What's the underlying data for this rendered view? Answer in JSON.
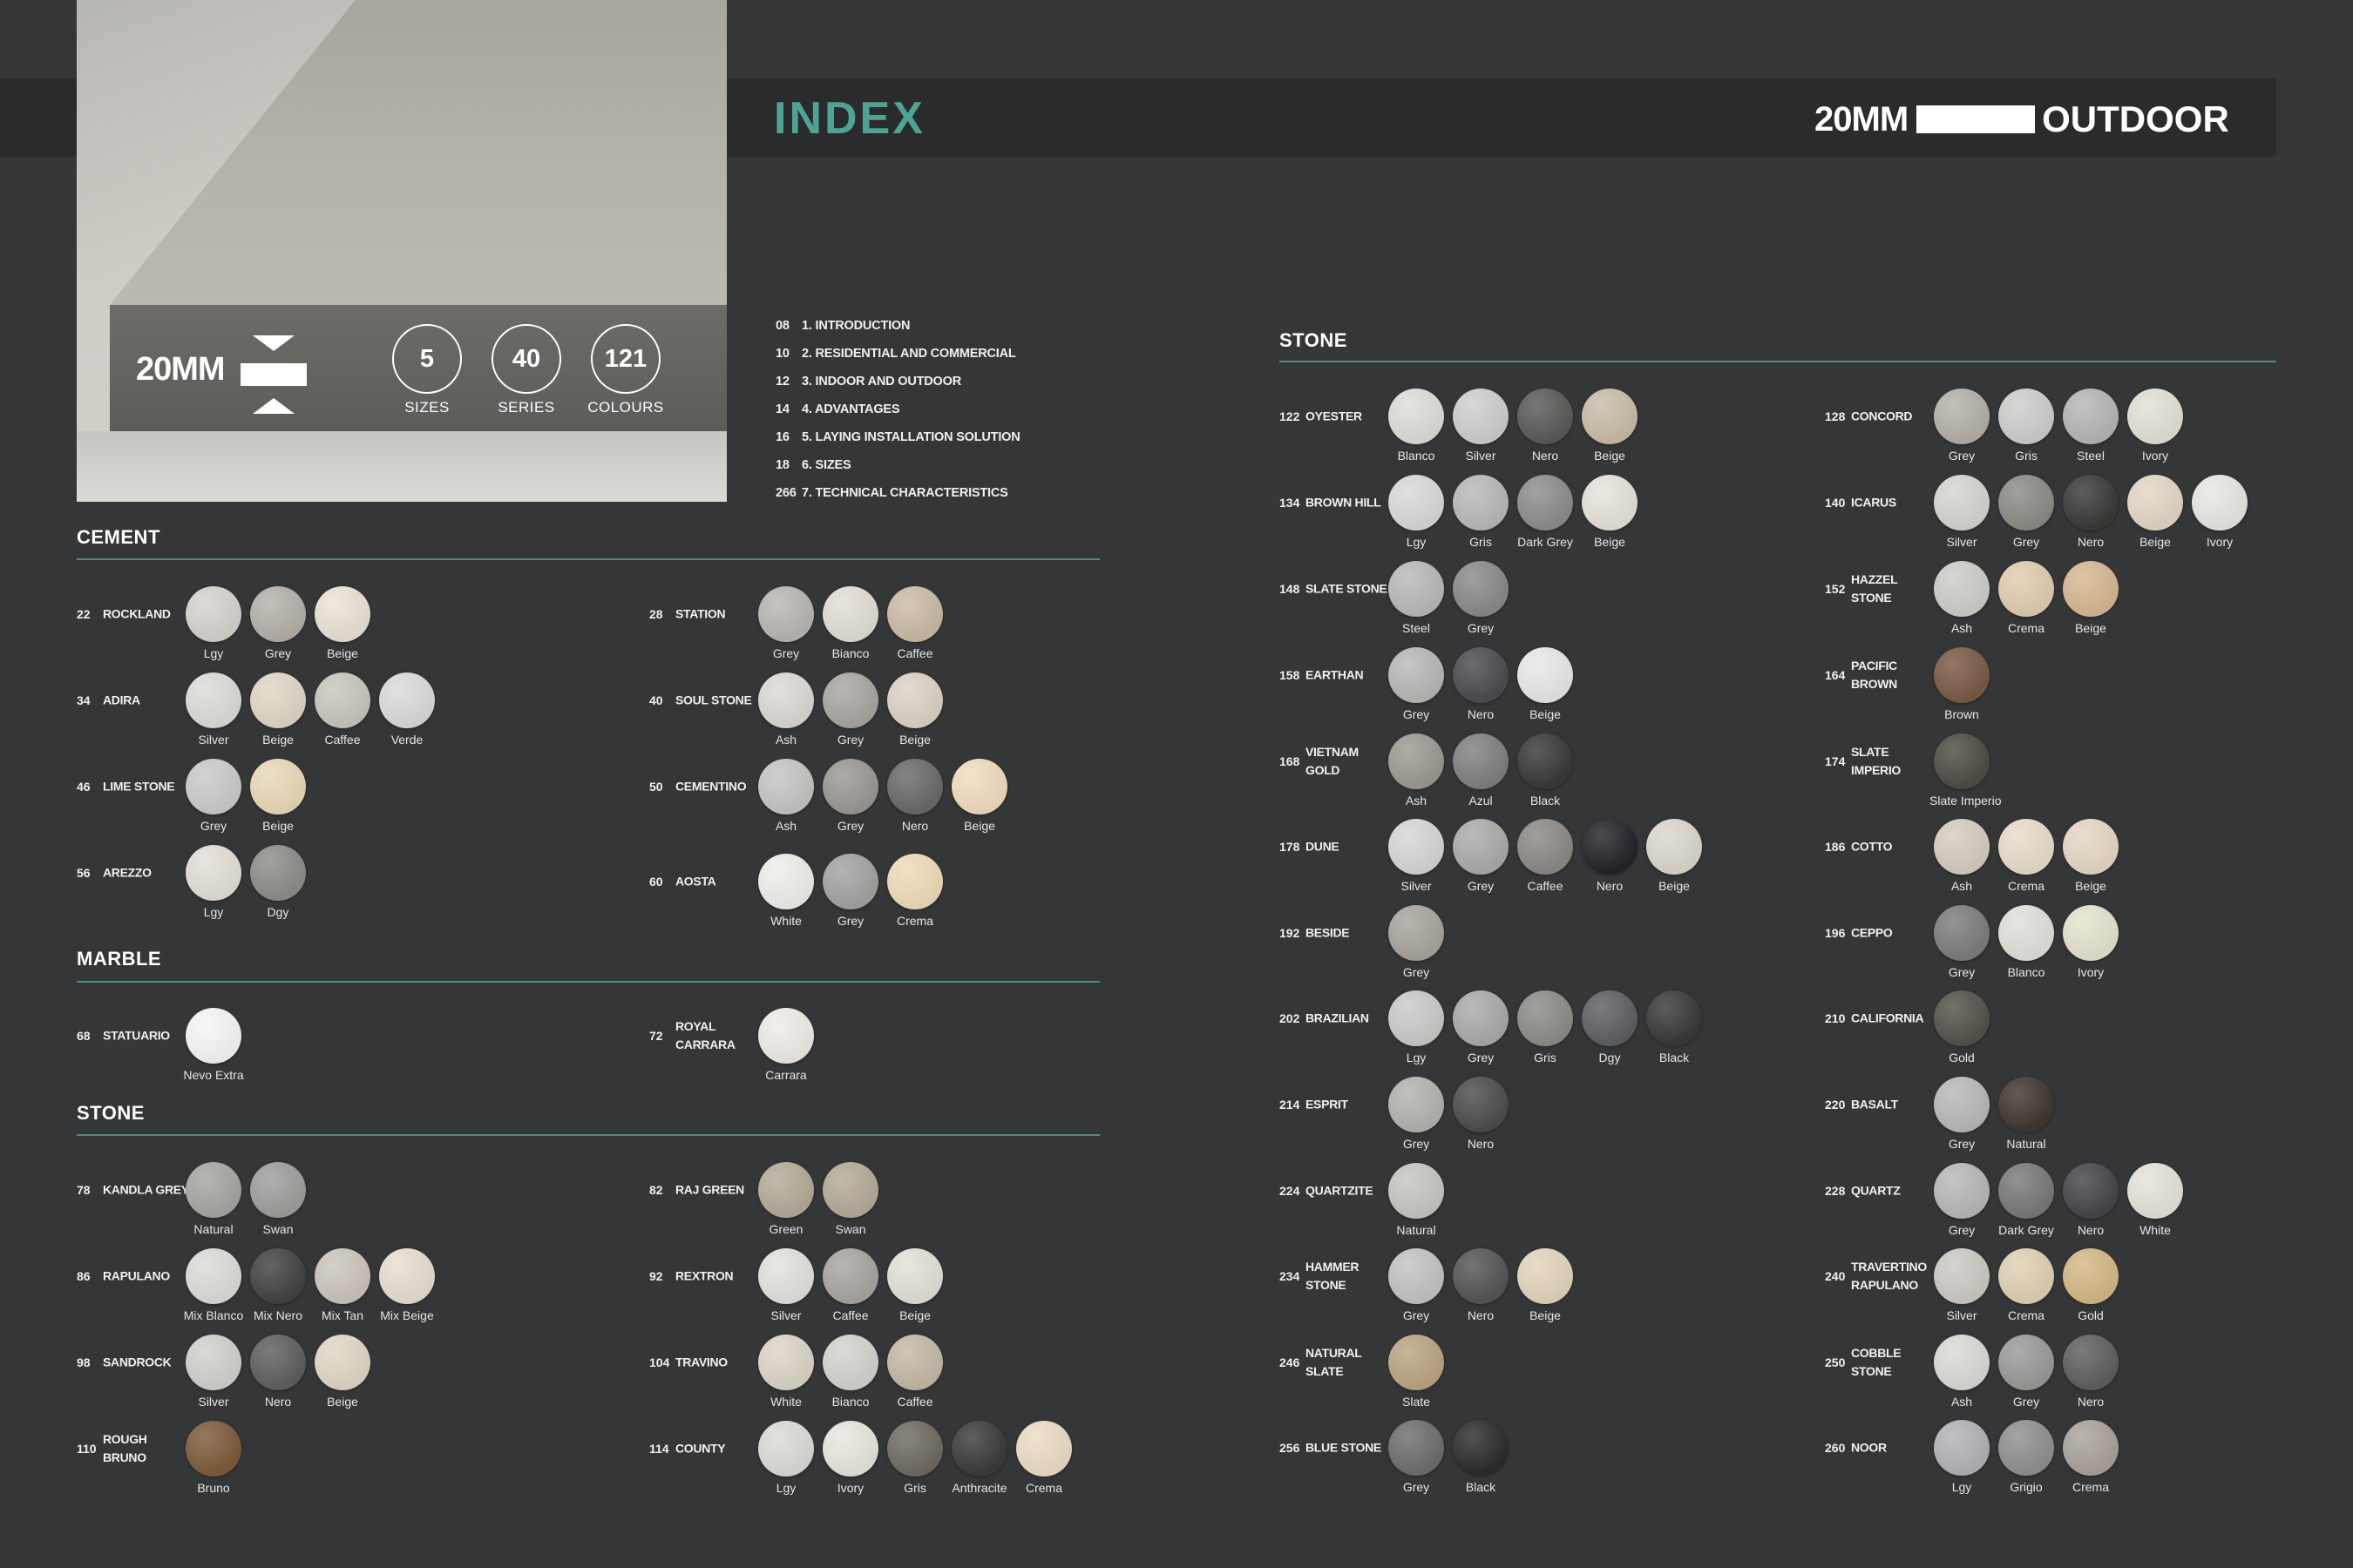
{
  "header": {
    "title": "INDEX",
    "brand_left": "20MM",
    "brand_right": "OUTDOOR"
  },
  "hero": {
    "thickness": "20MM",
    "stats": [
      {
        "value": "5",
        "label": "SIZES"
      },
      {
        "value": "40",
        "label": "SERIES"
      },
      {
        "value": "121",
        "label": "COLOURS"
      }
    ]
  },
  "toc": [
    {
      "page": "08",
      "label": "1. INTRODUCTION"
    },
    {
      "page": "10",
      "label": "2. RESIDENTIAL AND COMMERCIAL"
    },
    {
      "page": "12",
      "label": "3. INDOOR AND OUTDOOR"
    },
    {
      "page": "14",
      "label": "4. ADVANTAGES"
    },
    {
      "page": "16",
      "label": "5. LAYING INSTALLATION SOLUTION"
    },
    {
      "page": "18",
      "label": "6. SIZES"
    },
    {
      "page": "266",
      "label": "7. TECHNICAL CHARACTERISTICS"
    }
  ],
  "colors": {
    "accent": "#4fa394",
    "background": "#353638",
    "bar": "#2a2b2c"
  },
  "sections": [
    {
      "id": "cement",
      "title": "CEMENT",
      "items": [
        {
          "num": "22",
          "name": "ROCKLAND",
          "swatches": [
            [
              "Lgy",
              "#d6d3ce"
            ],
            [
              "Grey",
              "#b5b0a9"
            ],
            [
              "Beige",
              "#eae3d6"
            ]
          ]
        },
        {
          "num": "28",
          "name": "STATION",
          "swatches": [
            [
              "Grey",
              "#b9b6b2"
            ],
            [
              "Bianco",
              "#e2ded6"
            ],
            [
              "Caffee",
              "#cbbba7"
            ]
          ]
        },
        {
          "num": "34",
          "name": "ADIRA",
          "swatches": [
            [
              "Silver",
              "#dcdcd8"
            ],
            [
              "Beige",
              "#e0d7c6"
            ],
            [
              "Caffee",
              "#c9c6bf"
            ],
            [
              "Verde",
              "#d9ddd8"
            ]
          ]
        },
        {
          "num": "40",
          "name": "SOUL STONE",
          "swatches": [
            [
              "Ash",
              "#dcd9d5"
            ],
            [
              "Grey",
              "#a9a6a2"
            ],
            [
              "Beige",
              "#ddd3c6"
            ]
          ]
        },
        {
          "num": "46",
          "name": "LIME STONE",
          "swatches": [
            [
              "Grey",
              "#c9ccca"
            ],
            [
              "Beige",
              "#e9d9b8"
            ]
          ]
        },
        {
          "num": "50",
          "name": "CEMENTINO",
          "swatches": [
            [
              "Ash",
              "#c7c5c2"
            ],
            [
              "Grey",
              "#9b9894"
            ],
            [
              "Nero",
              "#6b6a68"
            ],
            [
              "Beige",
              "#f1dcbf"
            ]
          ]
        },
        {
          "num": "56",
          "name": "AREZZO",
          "swatches": [
            [
              "Lgy",
              "#e4dfd7"
            ],
            [
              "Dgy",
              "#8e8d89"
            ]
          ]
        },
        {
          "num": "60",
          "name": "AOSTA",
          "swatches": [
            [
              "White",
              "#efeeea"
            ],
            [
              "Grey",
              "#a5a3a0"
            ],
            [
              "Crema",
              "#efdcb9"
            ]
          ]
        }
      ]
    },
    {
      "id": "marble",
      "title": "MARBLE",
      "items": [
        {
          "num": "68",
          "name": "STATUARIO",
          "swatches": [
            [
              "Nevo Extra",
              "#f6f6f5"
            ]
          ]
        },
        {
          "num": "72",
          "name": "ROYAL CARRARA",
          "swatches": [
            [
              "Carrara",
              "#efece6"
            ]
          ]
        }
      ]
    },
    {
      "id": "stone-left",
      "title": "STONE",
      "items": [
        {
          "num": "78",
          "name": "KANDLA GREY",
          "swatches": [
            [
              "Natural",
              "#a6a6a2"
            ],
            [
              "Swan",
              "#9e9f9b"
            ]
          ]
        },
        {
          "num": "82",
          "name": "RAJ GREEN",
          "swatches": [
            [
              "Green",
              "#b4ac98"
            ],
            [
              "Swan",
              "#b5ab98"
            ]
          ]
        },
        {
          "num": "86",
          "name": "RAPULANO",
          "swatches": [
            [
              "Mix Blanco",
              "#dedcd8"
            ],
            [
              "Mix Nero",
              "#434343"
            ],
            [
              "Mix Tan",
              "#cbc5bc"
            ],
            [
              "Mix Beige",
              "#e6dfd2"
            ]
          ]
        },
        {
          "num": "92",
          "name": "REXTRON",
          "swatches": [
            [
              "Silver",
              "#e2e2de"
            ],
            [
              "Caffee",
              "#a9a5a0"
            ],
            [
              "Beige",
              "#e3e0d8"
            ]
          ]
        },
        {
          "num": "98",
          "name": "SANDROCK",
          "swatches": [
            [
              "Silver",
              "#d2d1cd"
            ],
            [
              "Nero",
              "#5f5f5e"
            ],
            [
              "Beige",
              "#e0d7c6"
            ]
          ]
        },
        {
          "num": "104",
          "name": "TRAVINO",
          "swatches": [
            [
              "White",
              "#dcd5c8"
            ],
            [
              "Bianco",
              "#d4d3ce"
            ],
            [
              "Caffee",
              "#c5b9a6"
            ]
          ]
        },
        {
          "num": "110",
          "name": "ROUGH BRUNO",
          "swatches": [
            [
              "Bruno",
              "#7d5c3a"
            ]
          ]
        },
        {
          "num": "114",
          "name": "COUNTY",
          "swatches": [
            [
              "Lgy",
              "#dcdbd7"
            ],
            [
              "Ivory",
              "#e9e6df"
            ],
            [
              "Gris",
              "#6f6a63"
            ],
            [
              "Anthracite",
              "#3d3b3a"
            ],
            [
              "Crema",
              "#ecdcc5"
            ]
          ]
        }
      ]
    },
    {
      "id": "stone-right",
      "title": "STONE",
      "items": [
        {
          "num": "122",
          "name": "OYESTER",
          "swatches": [
            [
              "Blanco",
              "#dfddd8"
            ],
            [
              "Silver",
              "#d0cecb"
            ],
            [
              "Nero",
              "#5c5a57"
            ],
            [
              "Beige",
              "#c9bda8"
            ]
          ]
        },
        {
          "num": "128",
          "name": "CONCORD",
          "swatches": [
            [
              "Grey",
              "#b5b0a9"
            ],
            [
              "Gris",
              "#cfcecb"
            ],
            [
              "Steel",
              "#b7b6b3"
            ],
            [
              "Ivory",
              "#e4e0d6"
            ]
          ]
        },
        {
          "num": "134",
          "name": "BROWN HILL",
          "swatches": [
            [
              "Lgy",
              "#d9d9d6"
            ],
            [
              "Gris",
              "#b9b9b7"
            ],
            [
              "Dark Grey",
              "#8c8d8e"
            ],
            [
              "Beige",
              "#e7e3da"
            ]
          ]
        },
        {
          "num": "140",
          "name": "ICARUS",
          "swatches": [
            [
              "Silver",
              "#d6d5d1"
            ],
            [
              "Grey",
              "#8d8b86"
            ],
            [
              "Nero",
              "#3c3a37"
            ],
            [
              "Beige",
              "#e3d7c6"
            ],
            [
              "Ivory",
              "#e8e7e3"
            ]
          ]
        },
        {
          "num": "148",
          "name": "SLATE STONE",
          "swatches": [
            [
              "Steel",
              "#b9b9b7"
            ],
            [
              "Grey",
              "#8a8a8a"
            ]
          ]
        },
        {
          "num": "152",
          "name": "HAZZEL STONE",
          "swatches": [
            [
              "Ash",
              "#cfcdc8"
            ],
            [
              "Crema",
              "#e1cdb0"
            ],
            [
              "Beige",
              "#d6b893"
            ]
          ]
        },
        {
          "num": "158",
          "name": "EARTHAN",
          "swatches": [
            [
              "Grey",
              "#b9b8b5"
            ],
            [
              "Nero",
              "#4a4c50"
            ],
            [
              "Beige",
              "#e9e8e5"
            ]
          ]
        },
        {
          "num": "164",
          "name": "PACIFIC BROWN",
          "swatches": [
            [
              "Brown",
              "#7a5a45"
            ]
          ]
        },
        {
          "num": "168",
          "name": "VIETNAM GOLD",
          "swatches": [
            [
              "Ash",
              "#9d9992"
            ],
            [
              "Azul",
              "#808080"
            ],
            [
              "Black",
              "#3a3938"
            ]
          ]
        },
        {
          "num": "174",
          "name": "SLATE IMPERIO",
          "swatches": [
            [
              "Slate Imperio",
              "#4f4c44"
            ]
          ]
        },
        {
          "num": "178",
          "name": "DUNE",
          "swatches": [
            [
              "Silver",
              "#d6d6d3"
            ],
            [
              "Grey",
              "#adaba8"
            ],
            [
              "Caffee",
              "#8c8985"
            ],
            [
              "Nero",
              "#222429"
            ],
            [
              "Beige",
              "#dcd7cd"
            ]
          ]
        },
        {
          "num": "186",
          "name": "COTTO",
          "swatches": [
            [
              "Ash",
              "#d5cdc1"
            ],
            [
              "Crema",
              "#e9ddca"
            ],
            [
              "Beige",
              "#e5d8c4"
            ]
          ]
        },
        {
          "num": "192",
          "name": "BESIDE",
          "swatches": [
            [
              "Grey",
              "#a9a49c"
            ]
          ]
        },
        {
          "num": "196",
          "name": "CEPPO",
          "swatches": [
            [
              "Grey",
              "#7b7e7c"
            ],
            [
              "Blanco",
              "#e2e0da"
            ],
            [
              "Ivory",
              "#e6e2cf"
            ]
          ]
        },
        {
          "num": "202",
          "name": "BRAZILIAN",
          "swatches": [
            [
              "Lgy",
              "#cbcac7"
            ],
            [
              "Grey",
              "#aaaaa8"
            ],
            [
              "Gris",
              "#8e8c88"
            ],
            [
              "Dgy",
              "#5d6062"
            ],
            [
              "Black",
              "#393939"
            ]
          ]
        },
        {
          "num": "210",
          "name": "CALIFORNIA",
          "swatches": [
            [
              "Gold",
              "#54524a"
            ]
          ]
        },
        {
          "num": "214",
          "name": "ESPRIT",
          "swatches": [
            [
              "Grey",
              "#b5b3af"
            ],
            [
              "Nero",
              "#4d4d4c"
            ]
          ]
        },
        {
          "num": "220",
          "name": "BASALT",
          "swatches": [
            [
              "Grey",
              "#bab9b7"
            ],
            [
              "Natural",
              "#3f3731"
            ]
          ]
        },
        {
          "num": "224",
          "name": "QUARTZITE",
          "swatches": [
            [
              "Natural",
              "#c8c6c1"
            ]
          ]
        },
        {
          "num": "228",
          "name": "QUARTZ",
          "swatches": [
            [
              "Grey",
              "#b8b8b6"
            ],
            [
              "Dark Grey",
              "#777a78"
            ],
            [
              "Nero",
              "#45464a"
            ],
            [
              "White",
              "#e6e2d9"
            ]
          ]
        },
        {
          "num": "234",
          "name": "HAMMER STONE",
          "swatches": [
            [
              "Grey",
              "#c3c3c1"
            ],
            [
              "Nero",
              "#545557"
            ],
            [
              "Beige",
              "#e2d5bc"
            ]
          ]
        },
        {
          "num": "240",
          "name": "TRAVERTINO RAPULANO",
          "swatches": [
            [
              "Silver",
              "#cdcac4"
            ],
            [
              "Crema",
              "#e0d1b3"
            ],
            [
              "Gold",
              "#d4b987"
            ]
          ]
        },
        {
          "num": "246",
          "name": "NATURAL SLATE",
          "swatches": [
            [
              "Slate",
              "#bba583"
            ]
          ]
        },
        {
          "num": "250",
          "name": "COBBLE STONE",
          "swatches": [
            [
              "Ash",
              "#dcdad6"
            ],
            [
              "Grey",
              "#9b9a97"
            ],
            [
              "Nero",
              "#5e605c"
            ]
          ]
        },
        {
          "num": "256",
          "name": "BLUE STONE",
          "swatches": [
            [
              "Grey",
              "#6e6e6e"
            ],
            [
              "Black",
              "#2c2c2c"
            ]
          ]
        },
        {
          "num": "260",
          "name": "NOOR",
          "swatches": [
            [
              "Lgy",
              "#b2b3b6"
            ],
            [
              "Grigio",
              "#8f9092"
            ],
            [
              "Crema",
              "#a9a39a"
            ]
          ]
        }
      ]
    }
  ]
}
